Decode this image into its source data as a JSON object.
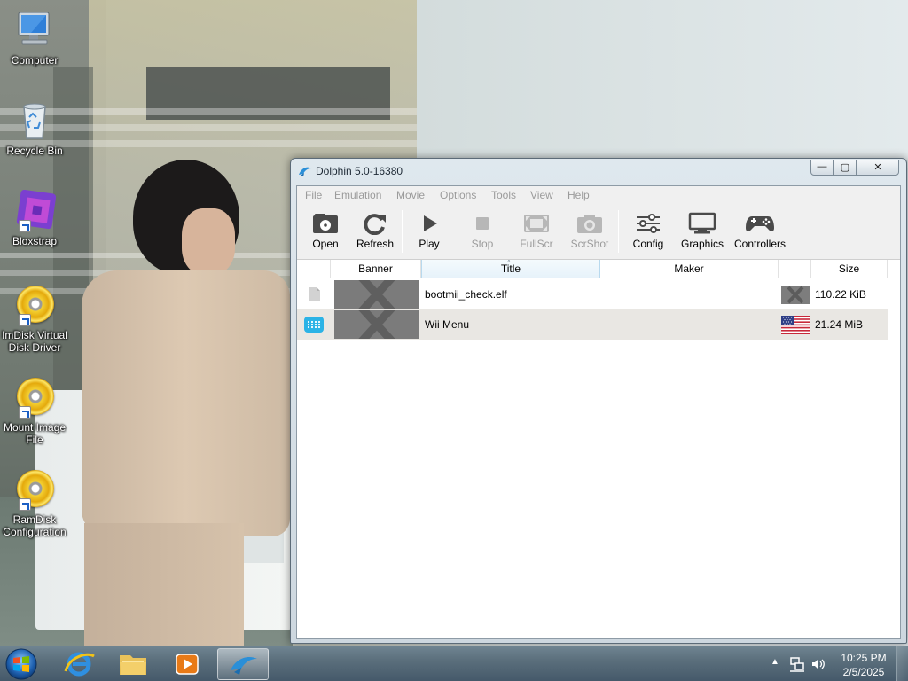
{
  "desktop": {
    "icons": [
      {
        "label": "Computer",
        "icon": "computer-icon"
      },
      {
        "label": "Recycle Bin",
        "icon": "recycle-bin-icon"
      },
      {
        "label": "Bloxstrap",
        "icon": "bloxstrap-icon"
      },
      {
        "label": "ImDisk Virtual Disk Driver",
        "icon": "disc-icon"
      },
      {
        "label": "Mount Image File",
        "icon": "disc-icon"
      },
      {
        "label": "RamDisk Configuration",
        "icon": "disc-icon"
      }
    ]
  },
  "window": {
    "title": "Dolphin 5.0-16380",
    "caption_buttons": {
      "minimize": "—",
      "maximize": "▢",
      "close": "✕"
    },
    "menu": [
      "File",
      "Emulation",
      "Movie",
      "Options",
      "Tools",
      "View",
      "Help"
    ],
    "toolbar": [
      {
        "label": "Open",
        "icon": "open-disc-icon",
        "enabled": true
      },
      {
        "label": "Refresh",
        "icon": "refresh-icon",
        "enabled": true
      },
      {
        "label": "Play",
        "icon": "play-icon",
        "enabled": true
      },
      {
        "label": "Stop",
        "icon": "stop-icon",
        "enabled": false
      },
      {
        "label": "FullScr",
        "icon": "fullscreen-icon",
        "enabled": false
      },
      {
        "label": "ScrShot",
        "icon": "camera-icon",
        "enabled": false
      },
      {
        "label": "Config",
        "icon": "sliders-icon",
        "enabled": true
      },
      {
        "label": "Graphics",
        "icon": "monitor-icon",
        "enabled": true
      },
      {
        "label": "Controllers",
        "icon": "gamepad-icon",
        "enabled": true
      }
    ],
    "game_list": {
      "columns": [
        "Banner",
        "Title",
        "Maker",
        "Size"
      ],
      "sort_indicator": "^",
      "rows": [
        {
          "platform": "file-icon",
          "title": "bootmii_check.elf",
          "maker": "",
          "region": "unknown-region-icon",
          "size": "110.22 KiB"
        },
        {
          "platform": "wii-wad-icon",
          "title": "Wii Menu",
          "maker": "",
          "region": "usa-flag-icon",
          "size": "21.24 MiB"
        }
      ]
    }
  },
  "taskbar": {
    "items": [
      "start-orb",
      "internet-explorer-icon",
      "file-explorer-icon",
      "media-player-icon",
      "dolphin-icon"
    ],
    "active": "dolphin-icon",
    "clock": {
      "time": "10:25 PM",
      "date": "2/5/2025"
    },
    "tray": [
      "show-hidden-icons",
      "network-icon",
      "volume-icon"
    ]
  },
  "colors": {
    "titlebar": "#cdd7df",
    "client_bg": "#f0f0f0",
    "alt_row": "#e9e7e3",
    "disabled_text": "#9b9b9b",
    "title_header_highlight": "#e6f2fa",
    "wii_icon": "#2bb3e6",
    "taskbar": "#5b6f7c"
  }
}
